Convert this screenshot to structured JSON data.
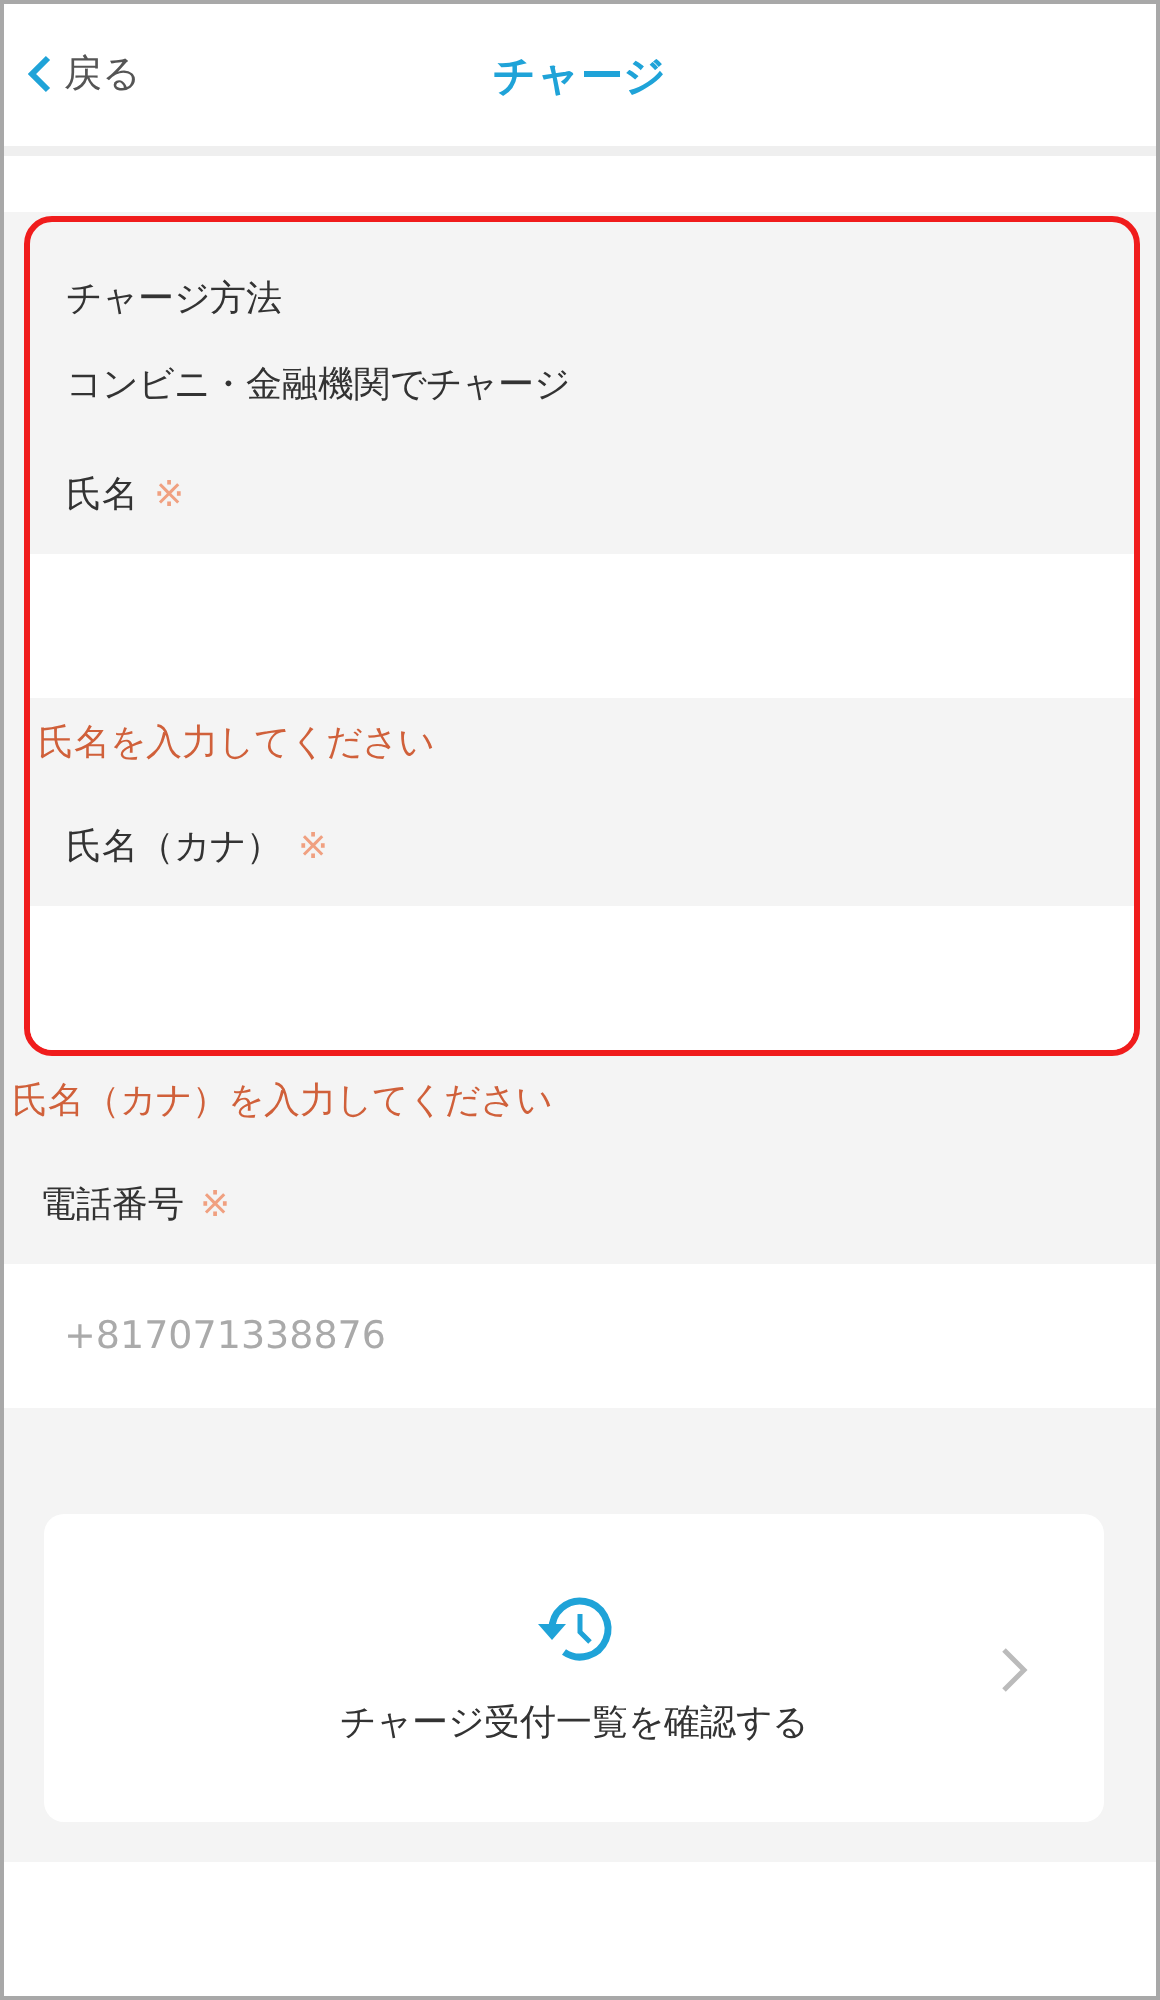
{
  "header": {
    "back_label": "戻る",
    "title": "チャージ"
  },
  "form": {
    "rows": [
      {
        "kind": "heading",
        "text": "チャージ方法",
        "highlighted": true
      },
      {
        "kind": "text",
        "text": "コンビニ・金融機関でチャージ",
        "highlighted": true
      },
      {
        "kind": "label",
        "text": "氏名",
        "mark": "※",
        "highlighted": true
      },
      {
        "kind": "input",
        "highlighted": true
      },
      {
        "kind": "error",
        "text": "氏名を入力してください",
        "highlighted": true
      },
      {
        "kind": "label",
        "text": "氏名（カナ）",
        "mark": "※",
        "highlighted": true
      },
      {
        "kind": "input",
        "highlighted": true
      },
      {
        "kind": "error",
        "text": "氏名（カナ）を入力してください",
        "highlighted": false
      },
      {
        "kind": "label",
        "text": "電話番号",
        "mark": "※",
        "highlighted": false
      },
      {
        "kind": "input",
        "placeholder": "+817071338876",
        "highlighted": false
      }
    ]
  },
  "history_card": {
    "label": "チャージ受付一覧を確認する"
  }
}
